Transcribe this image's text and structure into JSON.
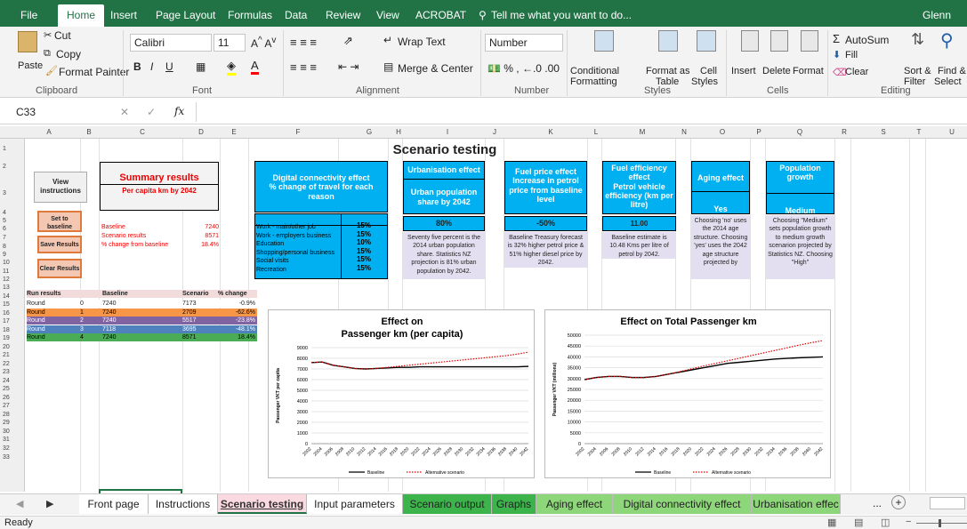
{
  "ribbon_tabs": [
    "File",
    "Home",
    "Insert",
    "Page Layout",
    "Formulas",
    "Data",
    "Review",
    "View",
    "ACROBAT"
  ],
  "tell_me": "Tell me what you want to do...",
  "user": "Glenn Lyon",
  "clipboard": {
    "paste": "Paste",
    "cut": "Cut",
    "copy": "Copy",
    "format_painter": "Format Painter",
    "label": "Clipboard"
  },
  "font": {
    "name": "Calibri",
    "size": "11",
    "label": "Font"
  },
  "alignment": {
    "wrap": "Wrap Text",
    "merge": "Merge & Center",
    "label": "Alignment"
  },
  "number": {
    "format": "Number",
    "label": "Number"
  },
  "styles": {
    "cond": "Conditional",
    "cond2": "Formatting",
    "format_as": "Format as",
    "table": "Table",
    "cell": "Cell",
    "cell2": "Styles",
    "label": "Styles"
  },
  "cells": {
    "insert": "Insert",
    "delete": "Delete",
    "format": "Format",
    "label": "Cells"
  },
  "editing": {
    "autosum": "AutoSum",
    "fill": "Fill",
    "clear": "Clear",
    "sort": "Sort &",
    "filter": "Filter",
    "find": "Find &",
    "select": "Select",
    "label": "Editing"
  },
  "name_box": "C33",
  "fx": "fx",
  "columns": [
    "A",
    "B",
    "C",
    "D",
    "E",
    "F",
    "G",
    "H",
    "I",
    "J",
    "K",
    "L",
    "M",
    "N",
    "O",
    "P",
    "Q",
    "R",
    "S",
    "T",
    "U"
  ],
  "rows": [
    "1",
    "2",
    "3",
    "4",
    "5",
    "6",
    "7",
    "8",
    "9",
    "10",
    "11",
    "12",
    "13",
    "14",
    "15",
    "16",
    "17",
    "18",
    "19",
    "20",
    "21",
    "22",
    "23",
    "24",
    "25",
    "26",
    "27",
    "28",
    "29",
    "30",
    "31",
    "32",
    "33"
  ],
  "sheet_title": "Scenario testing",
  "buttons": {
    "view": "View instructions",
    "set": "Set to baseline",
    "save": "Save Results",
    "clear": "Clear Results"
  },
  "summary": {
    "title": "Summary results",
    "subtitle": "Per capita km by 2042",
    "rows": [
      {
        "label": "Baseline",
        "value": "7240"
      },
      {
        "label": "Scenario results",
        "value": "8571"
      },
      {
        "label": "% change from baseline",
        "value": "18.4%"
      }
    ]
  },
  "digital": {
    "title": "Digital connectivity effect",
    "subtitle": "% change of travel for each reason",
    "items": [
      {
        "label": "Work - main/other job",
        "value": "15%"
      },
      {
        "label": "Work - employers business",
        "value": "15%"
      },
      {
        "label": "Education",
        "value": "10%"
      },
      {
        "label": "Shopping/personal business",
        "value": "15%"
      },
      {
        "label": "Social visits",
        "value": "15%"
      },
      {
        "label": "Recreation",
        "value": "15%"
      }
    ]
  },
  "urban": {
    "title": "Urbanisation effect",
    "subtitle": "Urban population share by 2042",
    "value": "80%",
    "note": "Seventy five percent is the 2014 urban population share. Statistics NZ projection is 81% urban population by 2042."
  },
  "fuel": {
    "title": "Fuel price effect",
    "subtitle": "Increase in petrol price from baseline level",
    "value": "-50%",
    "note": "Baseline Treasury forecast is 32% higher petrol price & 51% higher diesel price by 2042."
  },
  "efficiency": {
    "title": "Fuel efficiency effect",
    "subtitle": "Petrol vehicle efficiency (km per litre)",
    "value": "11.00",
    "note": "Baseline estimate is 10.48 Kms per litre of petrol by 2042."
  },
  "aging": {
    "title": "Aging effect",
    "value": "Yes",
    "note": "Choosing 'no' uses the 2014 age structure. Choosing 'yes' uses the 2042 age structure projected by"
  },
  "population": {
    "title": "Population growth",
    "value": "Medium",
    "note": "Choosing \"Medium\" sets population growth to medium growth scenarion projected by Statistics NZ. Choosing \"High\""
  },
  "run_table": {
    "headers": [
      "Run results",
      "",
      "Baseline",
      "Scenario",
      "% change"
    ],
    "rows": [
      {
        "name": "Round",
        "n": "0",
        "base": "7240",
        "scen": "7173",
        "pct": "-0.9%",
        "color": "#ffffff"
      },
      {
        "name": "Round",
        "n": "1",
        "base": "7240",
        "scen": "2709",
        "pct": "-62.6%",
        "color": "#f79646"
      },
      {
        "name": "Round",
        "n": "2",
        "base": "7240",
        "scen": "5517",
        "pct": "-23.8%",
        "color": "#8064a2"
      },
      {
        "name": "Round",
        "n": "3",
        "base": "7118",
        "scen": "3695",
        "pct": "-48.1%",
        "color": "#4f81bd"
      },
      {
        "name": "Round",
        "n": "4",
        "base": "7240",
        "scen": "8571",
        "pct": "18.4%",
        "color": "#4bac56"
      }
    ]
  },
  "chart_data": [
    {
      "type": "line",
      "title": "Effect on\nPassenger km (per capita)",
      "title_lines": [
        "Effect on",
        "Passenger km (per capita)"
      ],
      "ylabel": "Passenger VKT per capita",
      "xlabel": "",
      "ylim": [
        0,
        9000
      ],
      "yticks": [
        "0",
        "1000",
        "2000",
        "3000",
        "4000",
        "5000",
        "6000",
        "7000",
        "8000",
        "9000"
      ],
      "x": [
        "2002",
        "2004",
        "2006",
        "2008",
        "2010",
        "2012",
        "2014",
        "2016",
        "2018",
        "2020",
        "2022",
        "2024",
        "2026",
        "2028",
        "2030",
        "2032",
        "2034",
        "2036",
        "2038",
        "2040",
        "2042"
      ],
      "series": [
        {
          "name": "Baseline",
          "style": "solid",
          "color": "#000000",
          "values": [
            7600,
            7650,
            7350,
            7200,
            7050,
            7000,
            7050,
            7100,
            7150,
            7150,
            7200,
            7200,
            7200,
            7200,
            7200,
            7200,
            7200,
            7200,
            7200,
            7200,
            7240
          ]
        },
        {
          "name": "Alternative scenario",
          "style": "dotted",
          "color": "#e00000",
          "values": [
            7600,
            7650,
            7350,
            7200,
            7050,
            7000,
            7050,
            7150,
            7250,
            7350,
            7450,
            7550,
            7650,
            7750,
            7850,
            7950,
            8050,
            8150,
            8250,
            8400,
            8571
          ]
        }
      ],
      "legend": "bottom"
    },
    {
      "type": "line",
      "title": "Effect on  Total Passenger km",
      "title_lines": [
        "Effect on  Total Passenger km"
      ],
      "ylabel": "Passenger VKT (millions)",
      "xlabel": "",
      "ylim": [
        0,
        50000
      ],
      "yticks": [
        "0",
        "5000",
        "10000",
        "15000",
        "20000",
        "25000",
        "30000",
        "35000",
        "40000",
        "45000",
        "50000"
      ],
      "x": [
        "2002",
        "2004",
        "2006",
        "2008",
        "2010",
        "2012",
        "2014",
        "2016",
        "2018",
        "2020",
        "2022",
        "2024",
        "2026",
        "2028",
        "2030",
        "2032",
        "2034",
        "2036",
        "2038",
        "2040",
        "2042"
      ],
      "series": [
        {
          "name": "Baseline",
          "style": "solid",
          "color": "#000000",
          "values": [
            29500,
            30500,
            31000,
            31000,
            30500,
            30500,
            31000,
            32000,
            33000,
            34000,
            35000,
            36000,
            37000,
            37500,
            38000,
            38500,
            39000,
            39300,
            39600,
            39800,
            40000
          ]
        },
        {
          "name": "Alternative scenario",
          "style": "dotted",
          "color": "#e00000",
          "values": [
            29500,
            30500,
            31000,
            31000,
            30500,
            30500,
            31000,
            32000,
            33200,
            34500,
            35800,
            37000,
            38200,
            39400,
            40600,
            41800,
            43000,
            44200,
            45400,
            46500,
            47500
          ]
        }
      ],
      "legend": "bottom"
    }
  ],
  "sheet_tabs": [
    {
      "label": "Front page",
      "color": "#ffffff"
    },
    {
      "label": "Instructions",
      "color": "#ffffff"
    },
    {
      "label": "Scenario testing",
      "color": "#fbd9e0",
      "active": true
    },
    {
      "label": "Input parameters",
      "color": "#ffffff"
    },
    {
      "label": "Scenario output",
      "color": "#3cb44b"
    },
    {
      "label": "Graphs",
      "color": "#3cb44b"
    },
    {
      "label": "Aging effect",
      "color": "#8ed67a"
    },
    {
      "label": "Digital connectivity effect",
      "color": "#8ed67a"
    },
    {
      "label": "Urbanisation effec",
      "color": "#8ed67a"
    }
  ],
  "more_tabs": "...",
  "status": "Ready"
}
